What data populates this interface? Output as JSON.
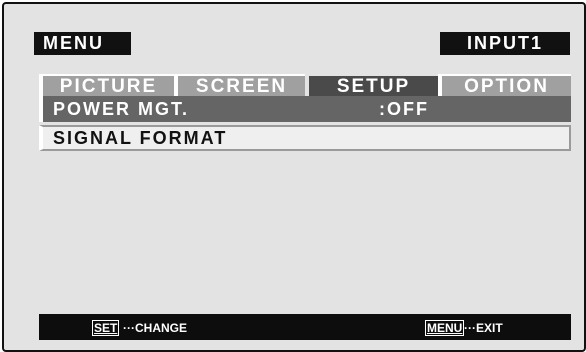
{
  "header": {
    "menu_label": "MENU",
    "input_label": "INPUT1"
  },
  "tabs": [
    {
      "label": "PICTURE",
      "active": false
    },
    {
      "label": "SCREEN",
      "active": false
    },
    {
      "label": "SETUP",
      "active": true
    },
    {
      "label": "OPTION",
      "active": false
    }
  ],
  "items": [
    {
      "label": "POWER MGT.",
      "value": ":OFF",
      "selected": true
    },
    {
      "label": "SIGNAL FORMAT",
      "value": "",
      "selected": false
    }
  ],
  "footer": {
    "set_key": "SET",
    "set_hint": "···CHANGE",
    "menu_key": "MENU",
    "menu_hint": "···EXIT"
  },
  "colors": {
    "frame": "#111111",
    "background": "#e3e3e3",
    "tab_inactive": "#a0a0a0",
    "tab_active": "#4a4a4a",
    "row_selected": "#656565",
    "row_normal": "#efefef",
    "statusbar": "#0d0d0d"
  }
}
